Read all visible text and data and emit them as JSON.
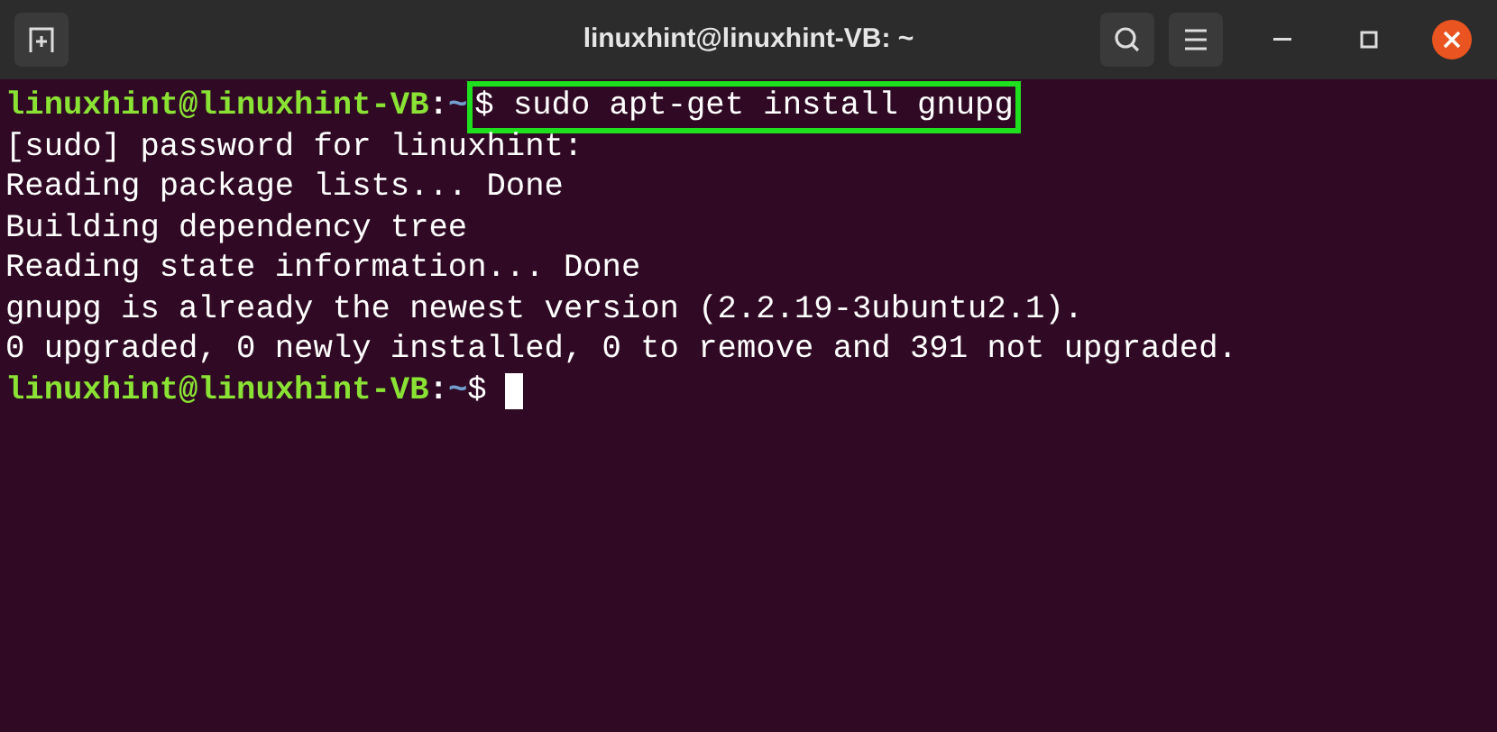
{
  "window": {
    "title": "linuxhint@linuxhint-VB: ~"
  },
  "terminal": {
    "lines": [
      {
        "kind": "prompt",
        "user_host": "linuxhint@linuxhint-VB",
        "separator": ":",
        "path": "~",
        "symbol": "$",
        "command": " sudo apt-get install gnupg",
        "highlighted": true,
        "cursor": false
      },
      {
        "kind": "output",
        "text": "[sudo] password for linuxhint:"
      },
      {
        "kind": "output",
        "text": "Reading package lists... Done"
      },
      {
        "kind": "output",
        "text": "Building dependency tree"
      },
      {
        "kind": "output",
        "text": "Reading state information... Done"
      },
      {
        "kind": "output",
        "text": "gnupg is already the newest version (2.2.19-3ubuntu2.1)."
      },
      {
        "kind": "output",
        "text": "0 upgraded, 0 newly installed, 0 to remove and 391 not upgraded."
      },
      {
        "kind": "prompt",
        "user_host": "linuxhint@linuxhint-VB",
        "separator": ":",
        "path": "~",
        "symbol": "$",
        "highlighted": false,
        "cursor": true
      }
    ]
  }
}
